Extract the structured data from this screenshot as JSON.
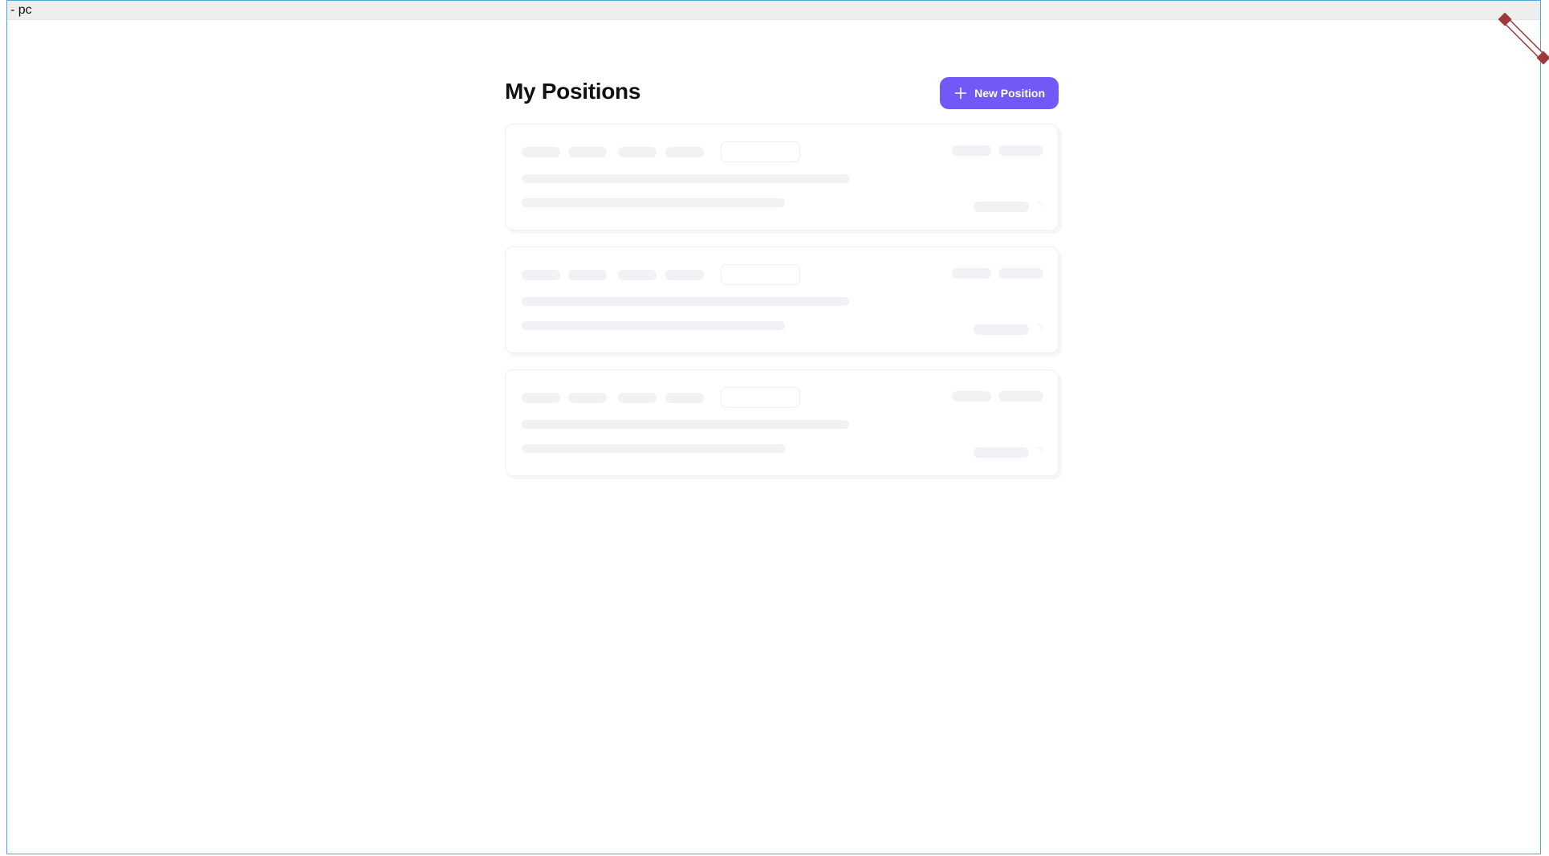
{
  "frame": {
    "label": "- pc"
  },
  "page": {
    "title": "My Positions"
  },
  "actions": {
    "new_position_label": "New Position"
  },
  "skeleton_cards": 3,
  "colors": {
    "accent": "#7059f6",
    "skeleton": "#f1f1f6",
    "frame_border": "#4aa8e0",
    "handle": "#9b3a3a"
  },
  "icons": {
    "new_position": "plus-icon",
    "frame_handle": "resize-handle-icon"
  }
}
